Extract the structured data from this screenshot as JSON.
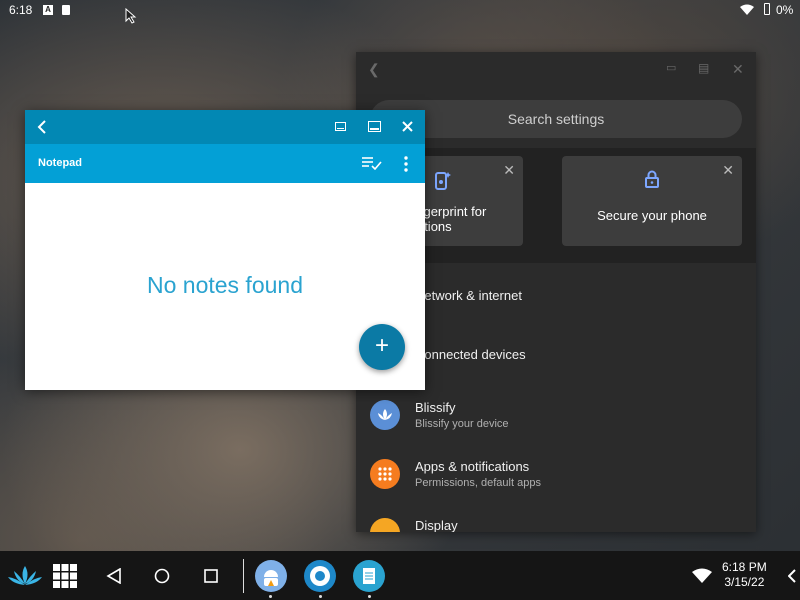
{
  "status_bar": {
    "time": "6:18",
    "notif_a": "A",
    "battery": "0%"
  },
  "settings": {
    "search_placeholder": "Search settings",
    "suggestions": [
      {
        "label": "Use fingerprint for notifications",
        "icon": "fingerprint-gesture-icon"
      },
      {
        "label": "Secure your phone",
        "icon": "lock-icon"
      }
    ],
    "items": [
      {
        "title": "Network & internet",
        "subtitle": "",
        "icon": "wifi-icon"
      },
      {
        "title": "Connected devices",
        "subtitle": "",
        "icon": "devices-icon"
      },
      {
        "title": "Blissify",
        "subtitle": "Blissify your device",
        "icon": "lotus-icon",
        "color": "#5b8fd6"
      },
      {
        "title": "Apps & notifications",
        "subtitle": "Permissions, default apps",
        "icon": "apps-grid-icon",
        "color": "#f57c1f"
      },
      {
        "title": "Display",
        "subtitle": "",
        "icon": "brightness-icon",
        "color": "#f5a623"
      }
    ]
  },
  "notepad": {
    "app_name": "Notepad",
    "empty_message": "No notes found",
    "fab_label": "+"
  },
  "taskbar": {
    "time": "6:18 PM",
    "date": "3/15/22",
    "apps": [
      "android-app-icon",
      "settings-gear-icon",
      "notepad-app-icon"
    ]
  },
  "colors": {
    "notepad_title": "#0288b4",
    "notepad_bar": "#03a0d6",
    "fab": "#0b7aa5"
  }
}
